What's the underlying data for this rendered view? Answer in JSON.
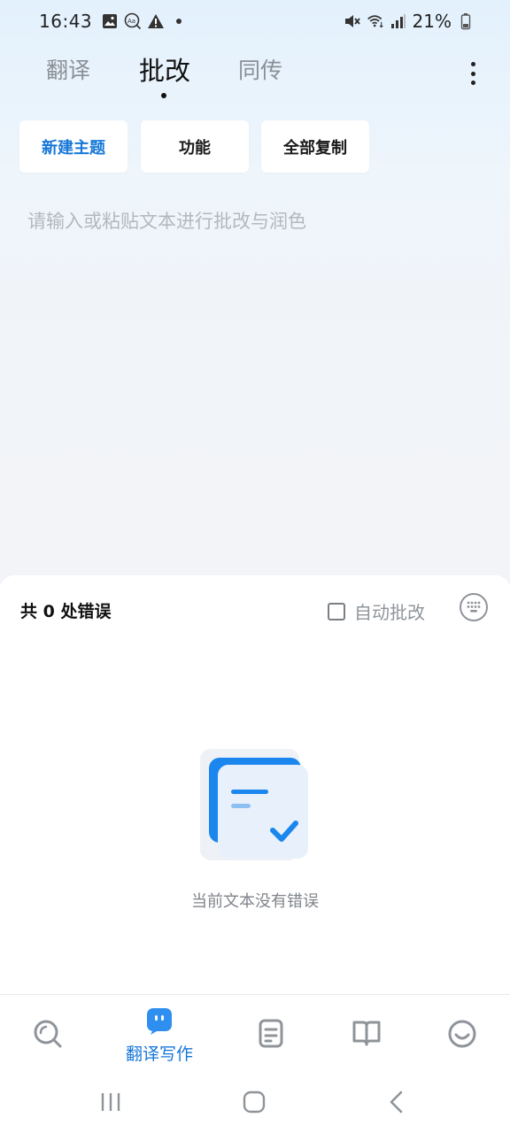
{
  "status_bar": {
    "time": "16:43",
    "left_icons": [
      "gallery-icon",
      "text-size-icon",
      "warning-icon",
      "dot-icon"
    ],
    "right_icons": [
      "mute-icon",
      "wifi-icon",
      "signal-icon",
      "battery-icon"
    ],
    "battery": "21%"
  },
  "tabs": [
    {
      "label": "翻译",
      "active": false
    },
    {
      "label": "批改",
      "active": true
    },
    {
      "label": "同传",
      "active": false
    }
  ],
  "actions": {
    "new_topic": "新建主题",
    "functions": "功能",
    "copy_all": "全部复制"
  },
  "editor": {
    "placeholder": "请输入或粘贴文本进行批改与润色"
  },
  "panel": {
    "error_prefix": "共",
    "error_count": "0",
    "error_suffix": "处错误",
    "auto_check_label": "自动批改",
    "auto_check_checked": false,
    "empty_text": "当前文本没有错误"
  },
  "bottom_nav": {
    "items": [
      {
        "icon": "search-icon",
        "label": ""
      },
      {
        "icon": "translate-write-icon",
        "label": "翻译写作",
        "active": true
      },
      {
        "icon": "document-icon",
        "label": ""
      },
      {
        "icon": "book-icon",
        "label": ""
      },
      {
        "icon": "smile-icon",
        "label": ""
      }
    ]
  },
  "colors": {
    "accent": "#1677d8",
    "muted": "#8a8f96"
  }
}
